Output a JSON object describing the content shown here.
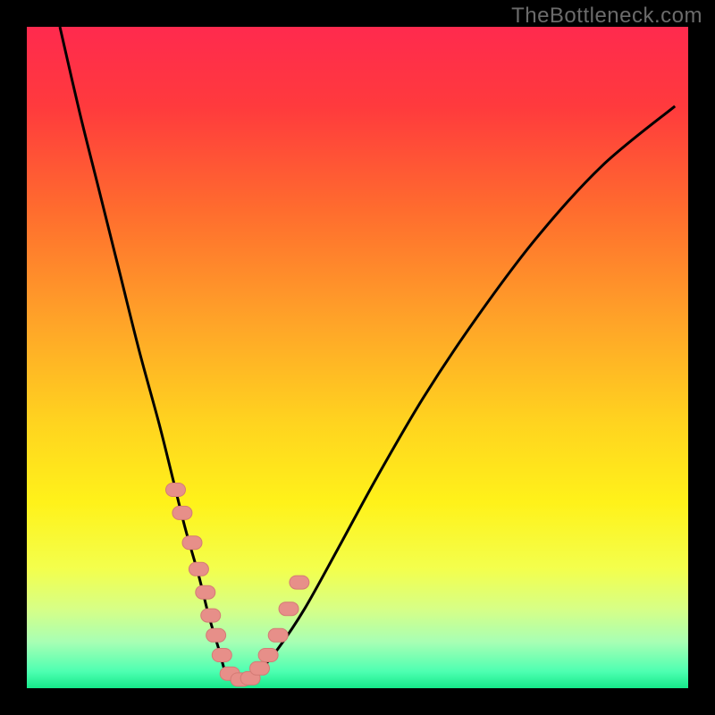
{
  "watermark": {
    "text": "TheBottleneck.com"
  },
  "colors": {
    "frame": "#000000",
    "curve": "#000000",
    "marker_fill": "#e78f89",
    "marker_stroke": "#d47b75",
    "gradient_stops": [
      {
        "offset": 0.0,
        "color": "#ff2a4e"
      },
      {
        "offset": 0.12,
        "color": "#ff3a3d"
      },
      {
        "offset": 0.28,
        "color": "#ff6d2e"
      },
      {
        "offset": 0.45,
        "color": "#ffa528"
      },
      {
        "offset": 0.6,
        "color": "#ffd41f"
      },
      {
        "offset": 0.72,
        "color": "#fff21a"
      },
      {
        "offset": 0.82,
        "color": "#f3ff4d"
      },
      {
        "offset": 0.88,
        "color": "#d7ff86"
      },
      {
        "offset": 0.93,
        "color": "#a8ffb4"
      },
      {
        "offset": 0.975,
        "color": "#4dffb1"
      },
      {
        "offset": 1.0,
        "color": "#15e98a"
      }
    ]
  },
  "chart_data": {
    "type": "line",
    "title": "",
    "xlabel": "",
    "ylabel": "",
    "xlim": [
      0,
      100
    ],
    "ylim": [
      0,
      100
    ],
    "series": [
      {
        "name": "bottleneck-curve",
        "x": [
          5,
          8,
          11,
          14,
          17,
          20,
          22,
          24,
          26,
          27.5,
          29,
          30,
          31,
          32.5,
          35,
          38,
          42,
          47,
          53,
          60,
          68,
          77,
          87,
          98
        ],
        "values": [
          100,
          87,
          75,
          63,
          51,
          40,
          32,
          24,
          17,
          11,
          6,
          2.5,
          1.2,
          1.2,
          2.5,
          6,
          12,
          21,
          32,
          44,
          56,
          68,
          79,
          88
        ]
      }
    ],
    "markers": {
      "name": "highlighted-points",
      "x": [
        22.5,
        23.5,
        25,
        26,
        27,
        27.8,
        28.6,
        29.5,
        30.7,
        32.3,
        33.8,
        35.2,
        36.5,
        38,
        39.6,
        41.2
      ],
      "values": [
        30,
        26.5,
        22,
        18,
        14.5,
        11,
        8,
        5,
        2.2,
        1.3,
        1.5,
        3,
        5,
        8,
        12,
        16
      ]
    }
  }
}
